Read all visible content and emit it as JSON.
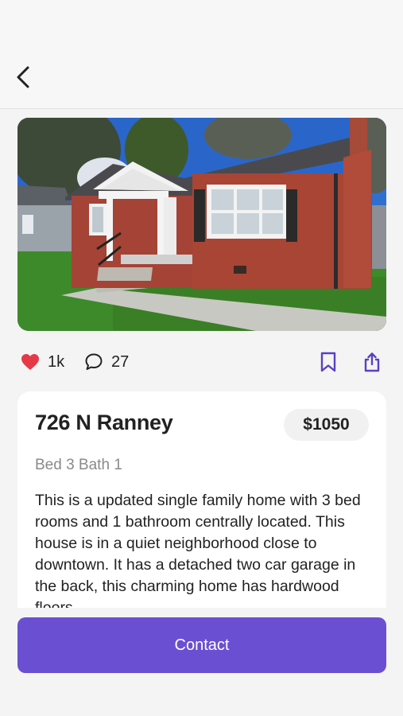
{
  "header": {
    "back_icon": "chevron-left-icon"
  },
  "listing": {
    "photo_icon": "house-photo",
    "likes": "1k",
    "comments": "27",
    "title": "726 N Ranney",
    "price": "$1050",
    "beds_baths": "Bed 3 Bath 1",
    "description": "This is a updated single family home with 3 bed rooms and 1 bathroom centrally located. This house is in a quiet neighborhood close to downtown. It has a detached two car garage in the back, this charming home has hardwood floors"
  },
  "actions": {
    "like_icon": "heart-icon",
    "comment_icon": "comment-icon",
    "bookmark_icon": "bookmark-icon",
    "share_icon": "share-icon"
  },
  "contact_label": "Contact",
  "colors": {
    "accent": "#6b4fd2",
    "heart": "#e53948",
    "icon_accent": "#5b3fc4"
  }
}
